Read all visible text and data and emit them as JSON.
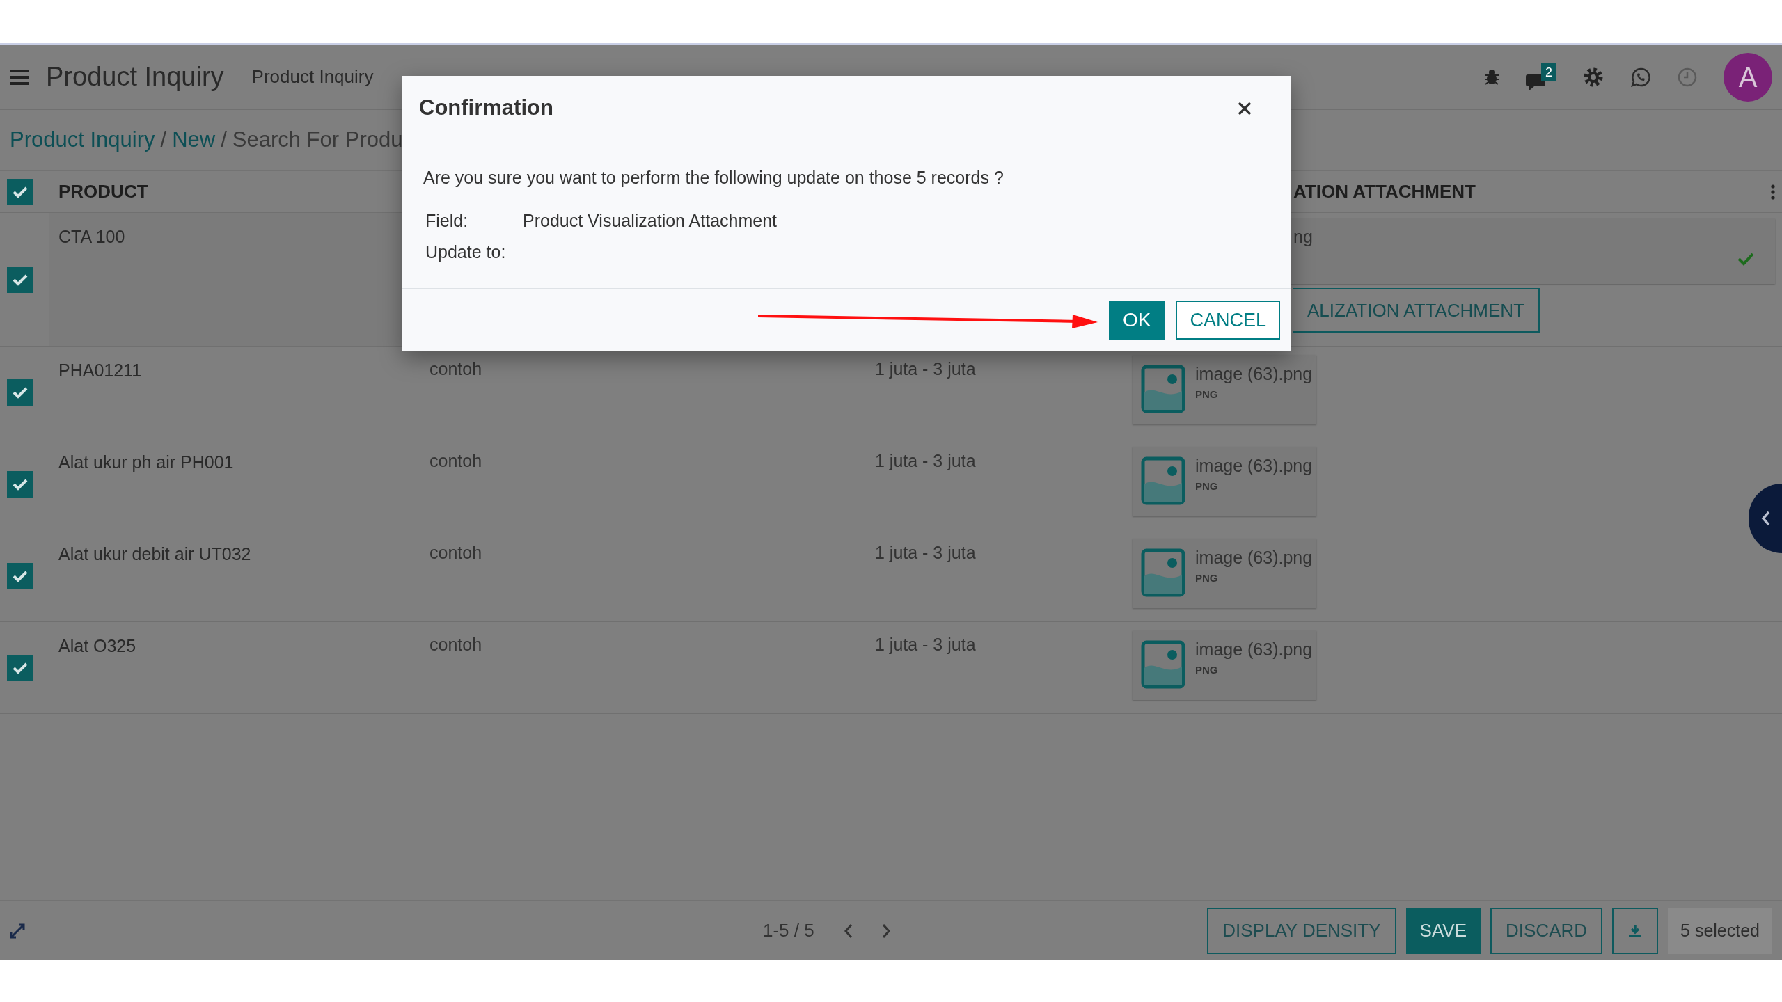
{
  "topbar": {
    "title": "Product Inquiry",
    "menu": [
      "Product Inquiry"
    ],
    "message_count": "2",
    "avatar": "A"
  },
  "breadcrumb": [
    {
      "label": "Product Inquiry",
      "kind": "link"
    },
    {
      "label": "/",
      "kind": "separator"
    },
    {
      "label": "New",
      "kind": "link"
    },
    {
      "label": "/",
      "kind": "separator"
    },
    {
      "label": "Search For Produ",
      "kind": "current"
    }
  ],
  "table": {
    "all_checked": true,
    "product_header": "PRODUCT",
    "attachment_header": "ATION ATTACHMENT",
    "rows": [
      {
        "kind": "editing",
        "checked": true,
        "product": "CTA 100",
        "attachment_text": "ng",
        "upload_button": "ALIZATION ATTACHMENT"
      },
      {
        "kind": "record",
        "checked": true,
        "product": "PHA01211",
        "column_2": "contoh",
        "column_3": "1 juta - 3 juta",
        "file_name": "image (63).png",
        "file_type": "PNG"
      },
      {
        "kind": "record",
        "checked": true,
        "product": "Alat ukur ph air PH001",
        "column_2": "contoh",
        "column_3": "1 juta - 3 juta",
        "file_name": "image (63).png",
        "file_type": "PNG"
      },
      {
        "kind": "record",
        "checked": true,
        "product": "Alat ukur debit air UT032",
        "column_2": "contoh",
        "column_3": "1 juta - 3 juta",
        "file_name": "image (63).png",
        "file_type": "PNG"
      },
      {
        "kind": "record",
        "checked": true,
        "product": "Alat O325",
        "column_2": "contoh",
        "column_3": "1 juta - 3 juta",
        "file_name": "image (63).png",
        "file_type": "PNG"
      }
    ]
  },
  "footer": {
    "pager": "1-5 / 5",
    "buttons": [
      {
        "label": "DISPLAY DENSITY",
        "kind": "outline"
      },
      {
        "label": "SAVE",
        "kind": "primary"
      },
      {
        "label": "DISCARD",
        "kind": "outline"
      },
      {
        "kind": "download"
      },
      {
        "label": "5 selected",
        "kind": "plain"
      }
    ]
  },
  "dialog": {
    "title": "Confirmation",
    "message": "Are you sure you want to perform the following update on those 5 records ?",
    "field_label": "Field:",
    "field_value": "Product Visualization Attachment",
    "update_label": "Update to:",
    "buttons": [
      {
        "label": "OK",
        "kind": "primary"
      },
      {
        "label": "CANCEL",
        "kind": "secondary"
      }
    ]
  }
}
